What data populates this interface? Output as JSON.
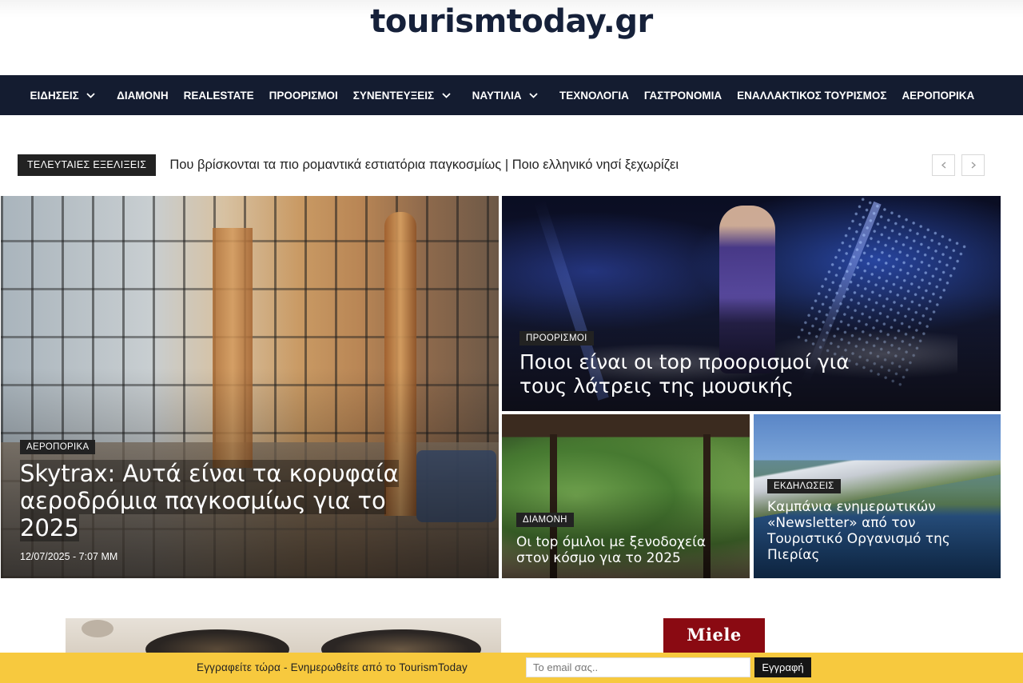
{
  "header": {
    "logo": "tourismtoday.gr"
  },
  "nav": {
    "items": [
      {
        "label": "ΕΙΔΗΣΕΙΣ",
        "has_submenu": true
      },
      {
        "label": "ΔΙΑΜΟΝΗ",
        "has_submenu": false
      },
      {
        "label": "REALESTATE",
        "has_submenu": false
      },
      {
        "label": "ΠΡΟΟΡΙΣΜΟΙ",
        "has_submenu": false
      },
      {
        "label": "ΣΥΝΕΝΤΕΥΞΕΙΣ",
        "has_submenu": true
      },
      {
        "label": "ΝΑΥΤΙΛΙΑ",
        "has_submenu": true
      },
      {
        "label": "ΤΕΧΝΟΛΟΓΙΑ",
        "has_submenu": false
      },
      {
        "label": "ΓΑΣΤΡΟΝΟΜΙΑ",
        "has_submenu": false
      },
      {
        "label": "ΕΝΑΛΛΑΚΤΙΚΟΣ ΤΟΥΡΙΣΜΟΣ",
        "has_submenu": false
      },
      {
        "label": "ΑΕΡΟΠΟΡΙΚΑ",
        "has_submenu": false
      }
    ]
  },
  "ticker": {
    "label": "ΤΕΛΕΥΤΑΙΕΣ ΕΞΕΛΙΞΕΙΣ",
    "headline": "Που βρίσκονται τα πιο ρομαντικά εστιατόρια παγκοσμίως | Ποιο ελληνικό νησί ξεχωρίζει",
    "prev_icon": "chevron-left-icon",
    "next_icon": "chevron-right-icon"
  },
  "featured": [
    {
      "category": "ΑΕΡΟΠΟΡΙΚΑ",
      "title": "Skytrax: Αυτά είναι τα κορυφαία αεροδρόμια παγκοσμίως για το 2025",
      "date": "12/07/2025 - 7:07 ΜΜ"
    },
    {
      "category": "ΠΡΟΟΡΙΣΜΟΙ",
      "title": "Ποιοι είναι οι top προορισμοί για τους λάτρεις της μουσικής"
    },
    {
      "category": "ΔΙΑΜΟΝΗ",
      "title": "Οι top όμιλοι με ξενοδοχεία στον κόσμο για το 2025"
    },
    {
      "category": "ΕΚΔΗΛΩΣΕΙΣ",
      "title": "Καμπάνια ενημερωτικών «Newsletter» από τον Τουριστικό Οργανισμό της Πιερίας"
    }
  ],
  "ads": {
    "right_brand": "Miele"
  },
  "newsletter": {
    "text": "Εγγραφείτε τώρα - Ενημερωθείτε από το TourismToday",
    "placeholder": "Το email σας..",
    "button": "Εγγραφή"
  },
  "colors": {
    "nav_bg": "#141c30",
    "logo": "#16213a",
    "newsletter_bg": "#f7c93e",
    "miele_red": "#8a0a12"
  }
}
